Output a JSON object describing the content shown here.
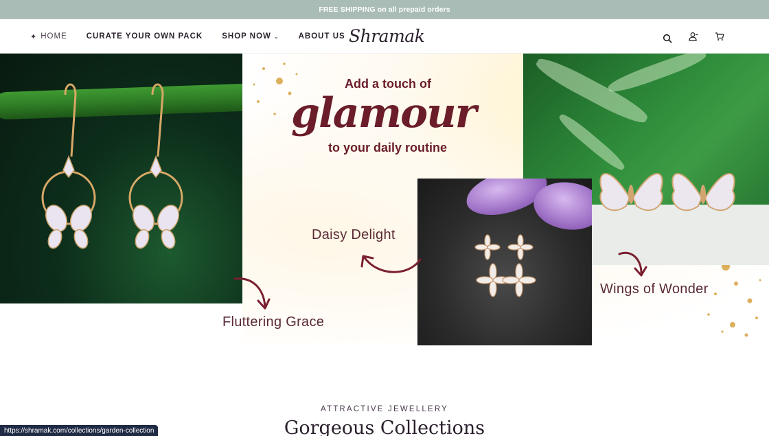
{
  "announcement": {
    "text": "FREE SHIPPING on all prepaid orders"
  },
  "header": {
    "logo": "Shramak",
    "nav": [
      {
        "label": "HOME",
        "icon": "sparkle-icon"
      },
      {
        "label": "CURATE YOUR OWN PACK"
      },
      {
        "label": "SHOP NOW",
        "icon": "chevron-down-icon"
      },
      {
        "label": "ABOUT US"
      }
    ],
    "icons": [
      "search-icon",
      "account-icon",
      "cart-icon"
    ]
  },
  "banner": {
    "headline_top": "Add a touch of",
    "headline_main": "glamour",
    "headline_bottom": "to your daily routine",
    "captions": {
      "left": "Fluttering Grace",
      "middle": "Daisy Delight",
      "right": "Wings of Wonder"
    },
    "accent_color": "#6b1d2a"
  },
  "collections": {
    "eyebrow": "ATTRACTIVE JEWELLERY",
    "title": "Gorgeous Collections"
  },
  "status_bar": {
    "url": "https://shramak.com/collections/garden-collection"
  },
  "colors": {
    "announcement_bg": "#a9bdb6",
    "text_dark": "#2a1f2c"
  }
}
